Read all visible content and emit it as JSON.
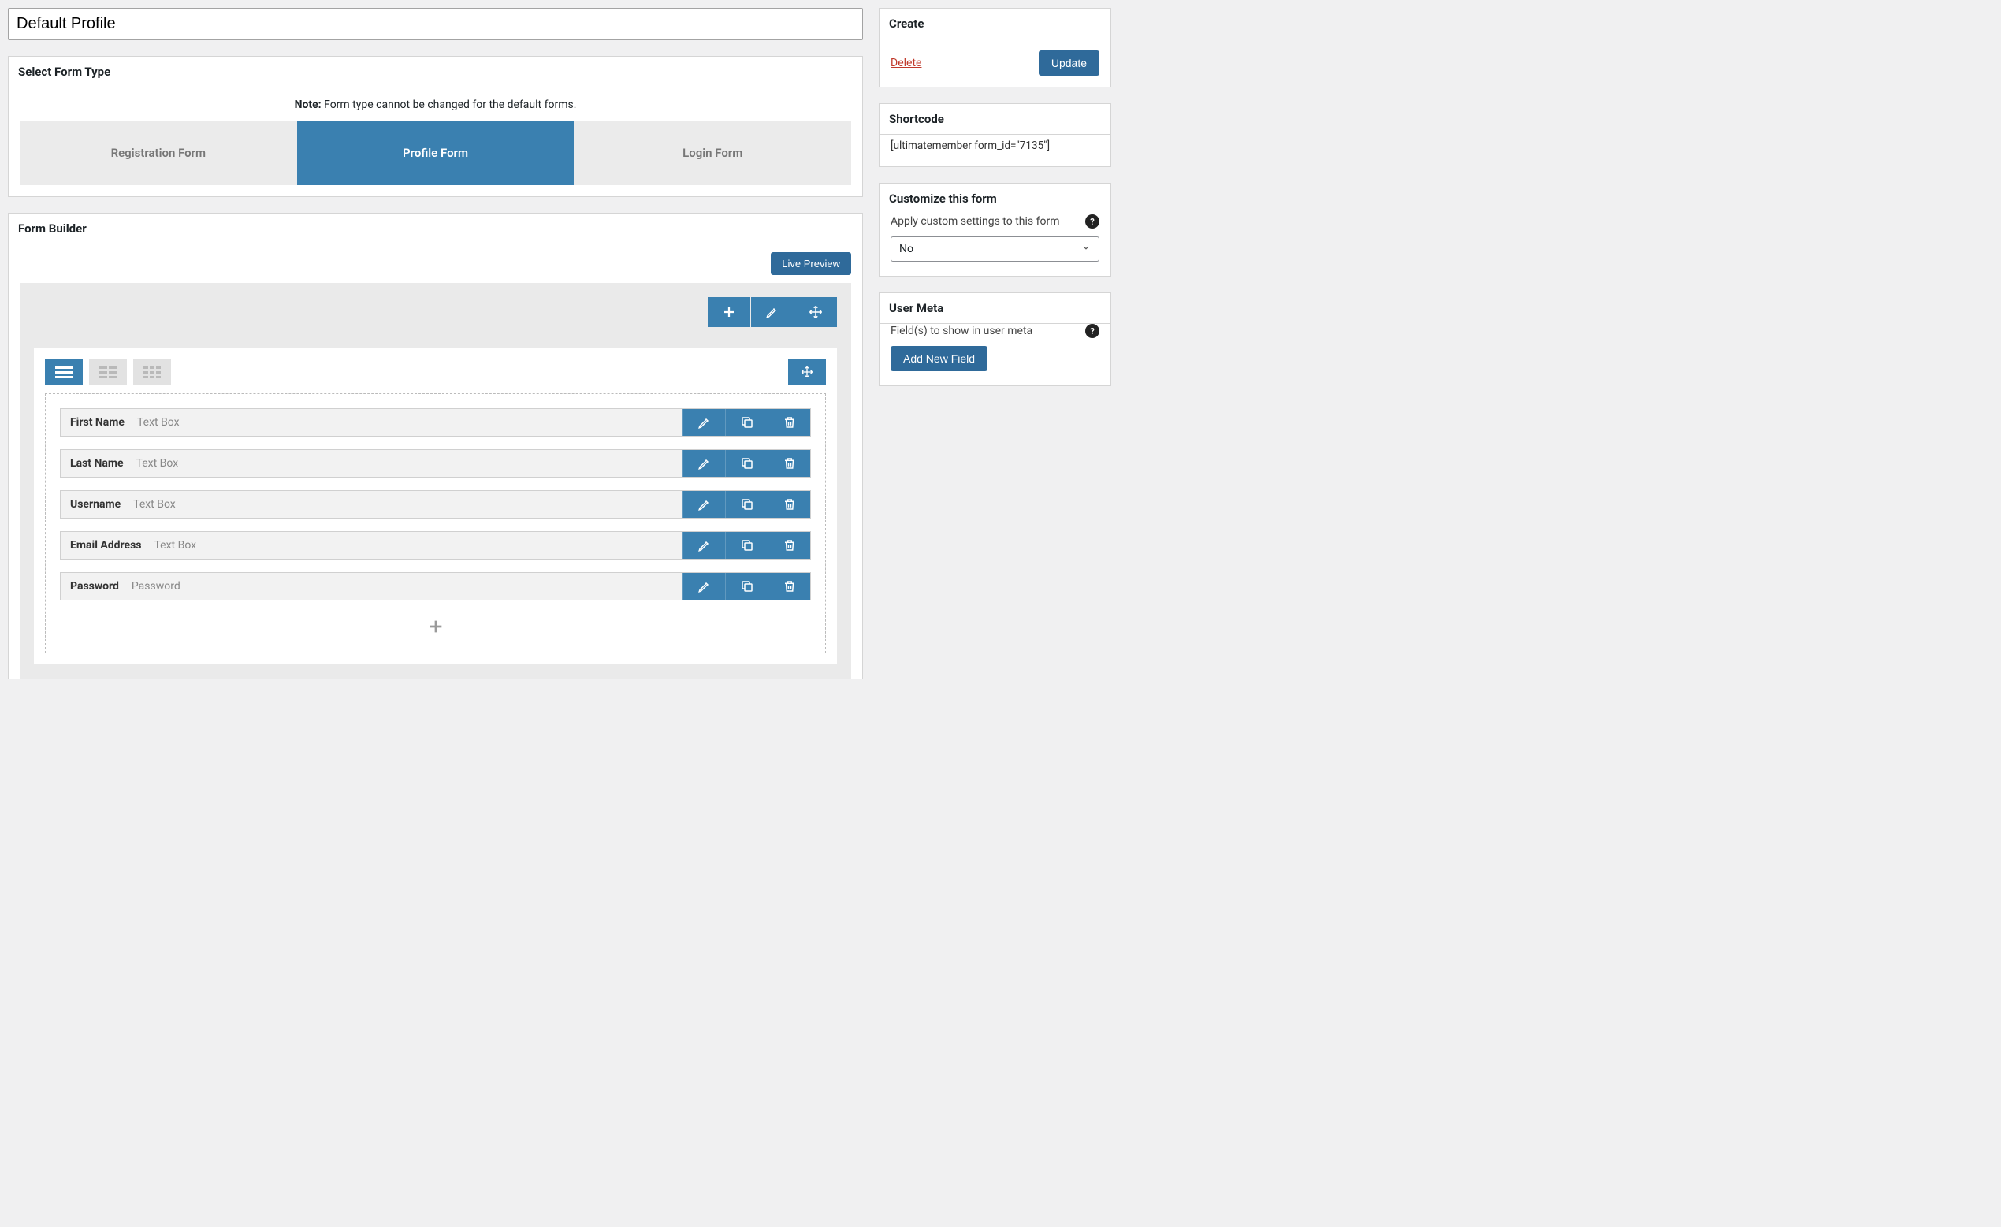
{
  "title": "Default Profile",
  "panels": {
    "form_type": {
      "heading": "Select Form Type",
      "note_label": "Note:",
      "note_text": "Form type cannot be changed for the default forms.",
      "tabs": [
        {
          "label": "Registration Form",
          "active": false
        },
        {
          "label": "Profile Form",
          "active": true
        },
        {
          "label": "Login Form",
          "active": false
        }
      ]
    },
    "form_builder": {
      "heading": "Form Builder",
      "live_preview": "Live Preview",
      "fields": [
        {
          "label": "First Name",
          "type": "Text Box"
        },
        {
          "label": "Last Name",
          "type": "Text Box"
        },
        {
          "label": "Username",
          "type": "Text Box"
        },
        {
          "label": "Email Address",
          "type": "Text Box"
        },
        {
          "label": "Password",
          "type": "Password"
        }
      ]
    }
  },
  "sidebar": {
    "create": {
      "heading": "Create",
      "delete": "Delete",
      "update": "Update"
    },
    "shortcode": {
      "heading": "Shortcode",
      "value": "[ultimatemember form_id=\"7135\"]"
    },
    "customize": {
      "heading": "Customize this form",
      "label": "Apply custom settings to this form",
      "value": "No"
    },
    "user_meta": {
      "heading": "User Meta",
      "label": "Field(s) to show in user meta",
      "button": "Add New Field"
    }
  }
}
